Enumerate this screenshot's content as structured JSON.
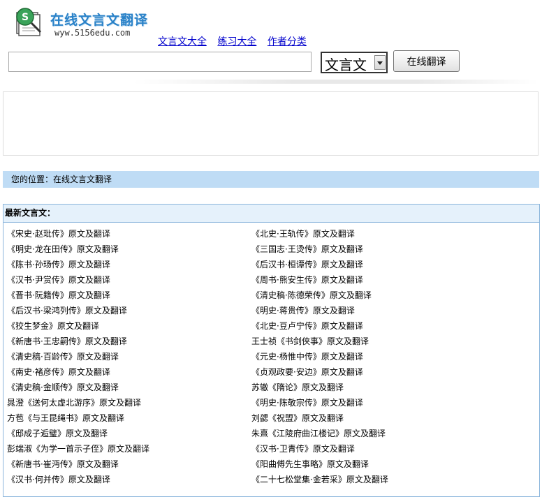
{
  "header": {
    "site_title": "在线文言文翻译",
    "site_url": "wyw.5156edu.com",
    "logo_letter": "S"
  },
  "nav": {
    "items": [
      {
        "label": "文言文大全"
      },
      {
        "label": "练习大全"
      },
      {
        "label": "作者分类"
      }
    ]
  },
  "search": {
    "value": "",
    "select_value": "文言文",
    "button_label": "在线翻译"
  },
  "breadcrumb": {
    "text": "您的位置：在线文言文翻译"
  },
  "latest": {
    "title": "最新文言文：",
    "left": [
      "《宋史·赵玭传》原文及翻译",
      "《明史·龙在田传》原文及翻译",
      "《陈书·孙玚传》原文及翻译",
      "《汉书·尹赏传》原文及翻译",
      "《晋书·阮籍传》原文及翻译",
      "《后汉书·梁鸿列传》原文及翻译",
      "《狡生梦金》原文及翻译",
      "《新唐书·王忠嗣传》原文及翻译",
      "《清史稿·百龄传》原文及翻译",
      "《南史·褚彦传》原文及翻译",
      "《清史稿·金顺传》原文及翻译",
      "晁澄《送何太虚北游序》原文及翻译",
      "方苞《与王昆绳书》原文及翻译",
      "《邸成子逅璧》原文及翻译",
      "彭端淑《为学一首示子侄》原文及翻译",
      "《新唐书·崔沔传》原文及翻译",
      "《汉书·何并传》原文及翻译"
    ],
    "right": [
      "《北史·王轨传》原文及翻译",
      "《三国志·王烫传》原文及翻译",
      "《后汉书·桓谭传》原文及翻译",
      "《周书·熊安生传》原文及翻译",
      "《清史稿·陈德荣传》原文及翻译",
      "《明史·蒋贵传》原文及翻译",
      "《北史·豆卢宁传》原文及翻译",
      "王士祯《书剑侠事》原文及翻译",
      "《元史·杨惟中传》原文及翻译",
      "《贞观政要·安边》原文及翻译",
      "苏辙《隋论》原文及翻译",
      "《明史·陈敬宗传》原文及翻译",
      "刘勰《祝盟》原文及翻译",
      "朱熹《江陵府曲江楼记》原文及翻译",
      "《汉书·卫青传》原文及翻译",
      "《阳曲傅先生事略》原文及翻译",
      "《二十七松堂集·金若采》原文及翻译"
    ]
  },
  "colors": {
    "link": "#0000cc",
    "breadcrumb_bg": "#bfdcf5",
    "panel_border": "#8cb6dc",
    "panel_head_bg": "#e5f1fb",
    "logo_blue": "#2a82c8"
  }
}
